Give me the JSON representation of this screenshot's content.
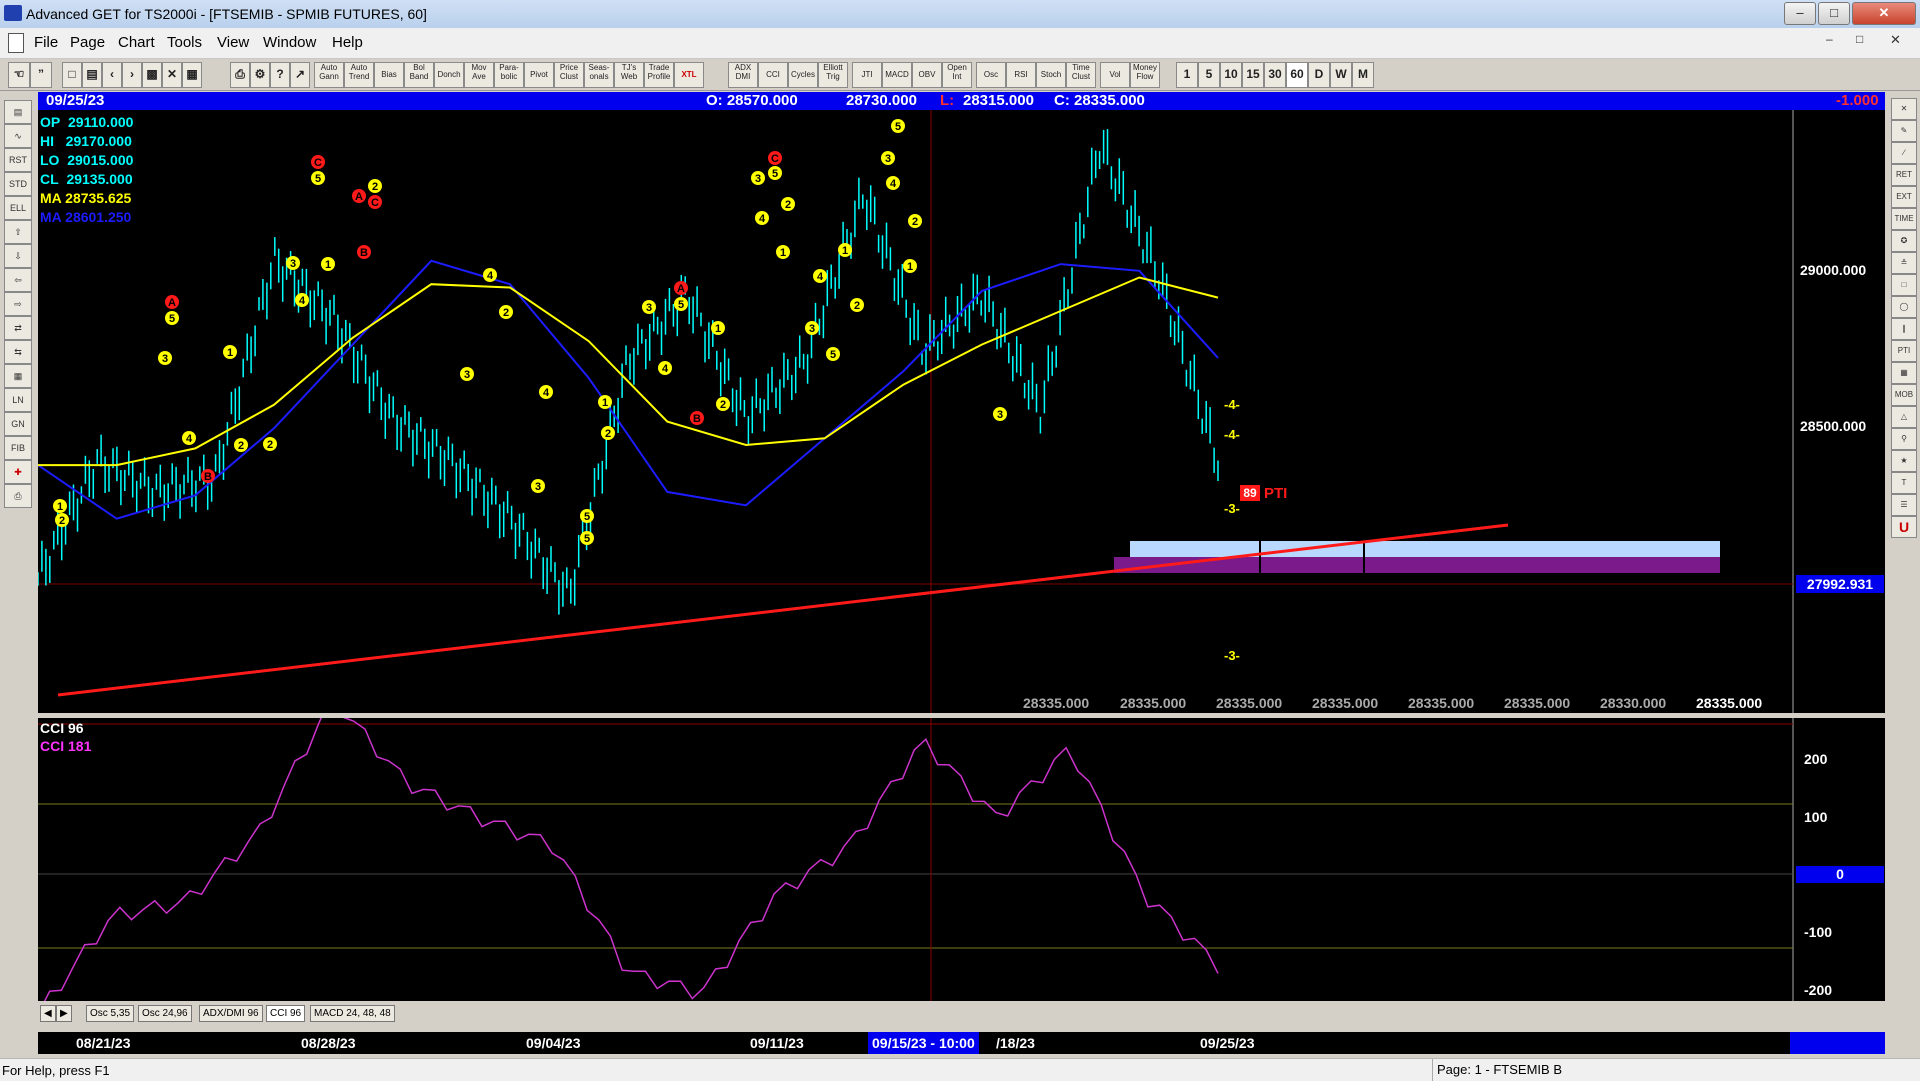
{
  "window": {
    "title": "Advanced GET for TS2000i - [FTSEMIB - SPMIB FUTURES, 60]"
  },
  "menu": [
    "File",
    "Page",
    "Chart",
    "Tools",
    "View",
    "Window",
    "Help"
  ],
  "toolbar": {
    "study_buttons": [
      "Auto Gann",
      "Auto Trend",
      "Bias",
      "Bol Band",
      "Donch",
      "Mov Ave",
      "Para-bolic",
      "Pivot",
      "Price Clust",
      "Seas-onals",
      "TJ's Web",
      "Trade Profile",
      "XTL",
      "ADX DMI",
      "CCI",
      "Cycles",
      "Elliott Trig",
      "JTI",
      "MACD",
      "OBV",
      "Open Int",
      "Osc",
      "RSI",
      "Stoch",
      "Time Clust",
      "Vol",
      "Money Flow"
    ],
    "timeframes": [
      "1",
      "5",
      "10",
      "15",
      "30",
      "60",
      "D",
      "W",
      "M"
    ]
  },
  "infobar": {
    "date": "09/25/23",
    "open": "O: 28570.000",
    "high": "28730.000",
    "low_label": "L:",
    "low": "28315.000",
    "close": "C: 28335.000",
    "change": "-1.000"
  },
  "legend": [
    {
      "label": "OP",
      "value": "29110.000",
      "color": "#00ffff"
    },
    {
      "label": "HI",
      "value": "29170.000",
      "color": "#00ffff"
    },
    {
      "label": "LO",
      "value": "29015.000",
      "color": "#00ffff"
    },
    {
      "label": "CL",
      "value": "29135.000",
      "color": "#00ffff"
    },
    {
      "label": "MA",
      "value": "28735.625",
      "color": "#ffff00"
    },
    {
      "label": "MA",
      "value": "28601.250",
      "color": "#1c1cff"
    }
  ],
  "price_axis": [
    "29000.000",
    "28500.000"
  ],
  "price_marker": "27992.931",
  "projection_values": [
    "28335.000",
    "28335.000",
    "28335.000",
    "28335.000",
    "28335.000",
    "28335.000",
    "28330.000",
    "28335.000"
  ],
  "chart_labels": {
    "pti_value": "89",
    "pti_label": "PTI",
    "proj_a": "-4-",
    "proj_b": "-4-",
    "proj_c": "-3-",
    "proj_d": "-3-"
  },
  "cci_panel": {
    "title": "CCI 96",
    "subtitle": "CCI  181",
    "axis": [
      "200",
      "100",
      "0",
      "-100",
      "-200"
    ]
  },
  "tabs": [
    "Osc 5,35",
    "Osc 24,96",
    "ADX/DMI 96",
    "CCI 96",
    "MACD 24, 48, 48"
  ],
  "dates": [
    "08/21/23",
    "08/28/23",
    "09/04/23",
    "09/11/23",
    "09/15/23 - 10:00",
    "/18/23",
    "09/25/23"
  ],
  "status": {
    "help": "For Help, press F1",
    "page": "Page: 1 - FTSEMIB B"
  },
  "colors": {
    "ma_fast": "#ffff00",
    "ma_slow": "#1c1cff",
    "bars": "#00ffff",
    "trendline": "#ff2020",
    "cci": "#cc33cc",
    "info_bg": "#0000ee"
  },
  "chart_data": {
    "type": "line",
    "instrument": "FTSEMIB - SPMIB FUTURES, 60",
    "ylim": [
      27600,
      29400
    ],
    "series": [
      {
        "name": "MA",
        "note": "yellow moving average",
        "values": [
          28340,
          28340,
          28390,
          28520,
          28720,
          28880,
          28870,
          28710,
          28470,
          28400,
          28420,
          28580,
          28700,
          28800,
          28900,
          28840
        ]
      },
      {
        "name": "MA",
        "note": "blue moving average",
        "values": [
          28340,
          28180,
          28250,
          28450,
          28700,
          28950,
          28880,
          28600,
          28260,
          28220,
          28420,
          28620,
          28860,
          28940,
          28920,
          28660
        ]
      }
    ],
    "cci": {
      "title": "CCI 96",
      "ylim": [
        -250,
        250
      ],
      "values": [
        -200,
        -60,
        -40,
        60,
        250,
        130,
        80,
        40,
        -140,
        -170,
        -30,
        40,
        190,
        80,
        180,
        -30,
        -130
      ]
    }
  }
}
